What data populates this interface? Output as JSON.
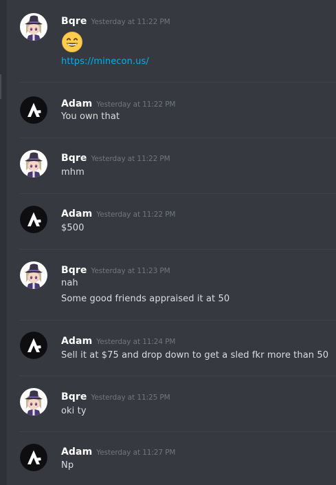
{
  "messages": [
    {
      "author": "Bqre",
      "avatar": "bqre-avatar-icon",
      "timestamp": "Yesterday at 11:22 PM",
      "emoji": "grinning-face-icon",
      "lines": [
        {
          "text": "https://minecon.us/",
          "link": true
        }
      ]
    },
    {
      "author": "Adam",
      "avatar": "adam-avatar-icon",
      "timestamp": "Yesterday at 11:22 PM",
      "lines": [
        {
          "text": "You own that"
        }
      ]
    },
    {
      "author": "Bqre",
      "avatar": "bqre-avatar-icon",
      "timestamp": "Yesterday at 11:22 PM",
      "lines": [
        {
          "text": "mhm"
        }
      ]
    },
    {
      "author": "Adam",
      "avatar": "adam-avatar-icon",
      "timestamp": "Yesterday at 11:22 PM",
      "lines": [
        {
          "text": "$500"
        }
      ]
    },
    {
      "author": "Bqre",
      "avatar": "bqre-avatar-icon",
      "timestamp": "Yesterday at 11:23 PM",
      "lines": [
        {
          "text": "nah"
        },
        {
          "text": "Some good friends appraised it at 50"
        }
      ]
    },
    {
      "author": "Adam",
      "avatar": "adam-avatar-icon",
      "timestamp": "Yesterday at 11:24 PM",
      "lines": [
        {
          "text": "Sell it at $75 and drop down to get a sled fkr more than 50"
        }
      ]
    },
    {
      "author": "Bqre",
      "avatar": "bqre-avatar-icon",
      "timestamp": "Yesterday at 11:25 PM",
      "lines": [
        {
          "text": "oki ty"
        }
      ]
    },
    {
      "author": "Adam",
      "avatar": "adam-avatar-icon",
      "timestamp": "Yesterday at 11:27 PM",
      "lines": [
        {
          "text": "Np"
        }
      ]
    }
  ],
  "colors": {
    "background": "#36393f",
    "username": "#ffffff",
    "timestamp": "#72767d",
    "message_text": "#dcddde",
    "link": "#00b0f4",
    "divider": "#40434a"
  }
}
